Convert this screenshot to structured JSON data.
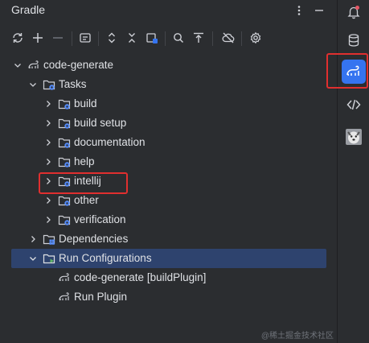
{
  "panel": {
    "title": "Gradle"
  },
  "tree": {
    "project": "code-generate",
    "tasks_label": "Tasks",
    "task_groups": [
      "build",
      "build setup",
      "documentation",
      "help",
      "intellij",
      "other",
      "verification"
    ],
    "dependencies_label": "Dependencies",
    "run_configurations_label": "Run Configurations",
    "run_configurations": [
      "code-generate [buildPlugin]",
      "Run Plugin"
    ]
  },
  "watermark": "@稀土掘金技术社区",
  "colors": {
    "panel_bg": "#2b2d30",
    "selection": "#2e436e",
    "accent_active": "#3574f0",
    "highlight_box": "#e02f2f",
    "text": "#dfe1e5",
    "icon": "#ced0d6",
    "folder_badge": "#548af7"
  }
}
